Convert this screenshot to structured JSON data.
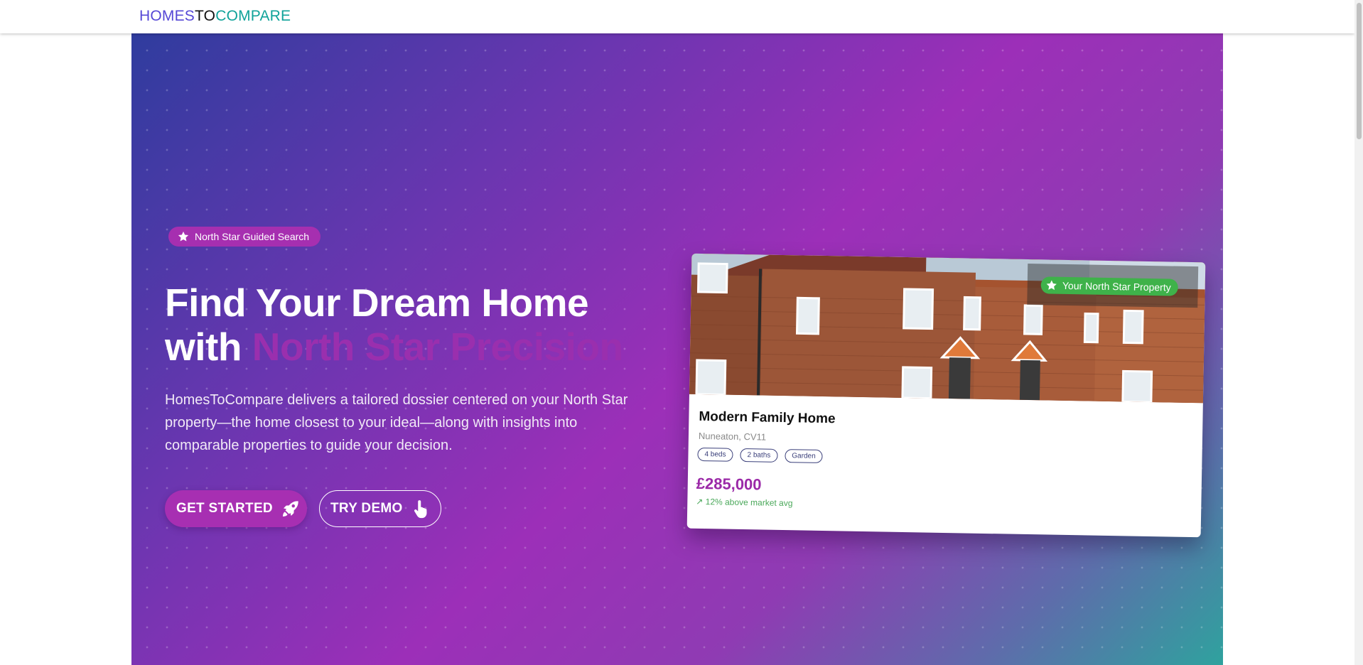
{
  "brand": {
    "part1": "HOMES",
    "part2": "TO",
    "part3": "COMPARE"
  },
  "hero": {
    "badge_label": "North Star Guided Search",
    "badge_icon": "star-icon",
    "headline_line1": "Find Your Dream Home",
    "headline_with": "with",
    "headline_accent": "North Star Precision",
    "lead_text": "HomesToCompare delivers a tailored dossier centered on your North Star property—the home closest to your ideal—along with insights into comparable properties to guide your decision.",
    "primary_button": {
      "label": "GET STARTED",
      "icon": "rocket-icon"
    },
    "secondary_button": {
      "label": "TRY DEMO",
      "icon": "pointer-hand-icon"
    }
  },
  "property_card": {
    "north_star_label": "Your North Star Property",
    "title": "Modern Family Home",
    "location": "Nuneaton, CV11",
    "tags": [
      "4 beds",
      "2 baths",
      "Garden"
    ],
    "price": "£285,000",
    "delta": "↗ 12% above market avg"
  },
  "colors": {
    "brand_blue": "#5648d6",
    "brand_teal": "#10a39a",
    "accent_purple": "#a72fb2",
    "positive_green": "#4aa85a",
    "badge_green": "#3fb24a"
  }
}
